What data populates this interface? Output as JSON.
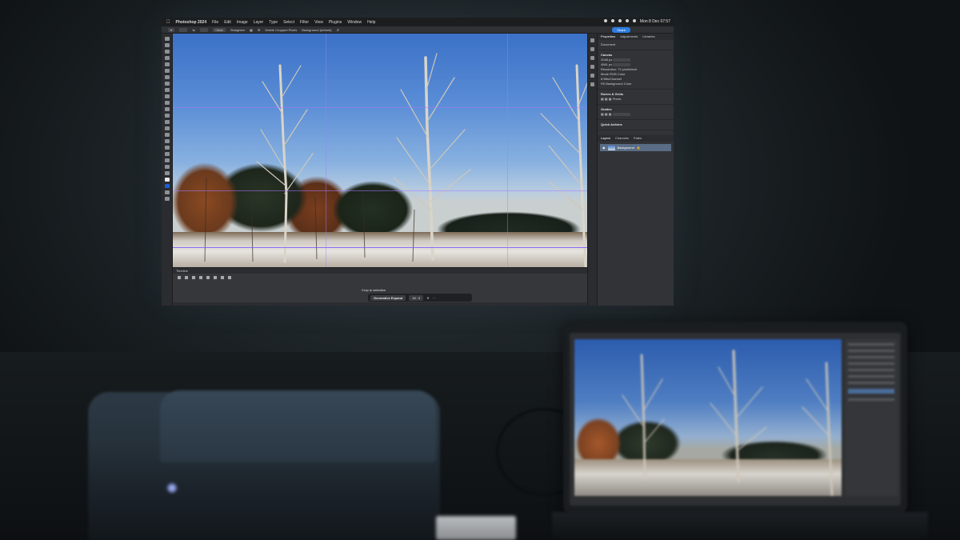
{
  "photoshop": {
    "app_name": "Photoshop 2024",
    "menus": [
      "File",
      "Edit",
      "Image",
      "Layer",
      "Type",
      "Select",
      "Filter",
      "View",
      "Plugins",
      "Window",
      "Help"
    ],
    "clock": "Mon 8 Dec  07:57",
    "share_label": "Share",
    "options": {
      "clear_label": "Clear",
      "straighten_label": "Straighten",
      "delete_cropped": "Delete Cropped Pixels",
      "fill_label": "Background (default)"
    },
    "panels": {
      "tabs": [
        "Properties",
        "Adjustments",
        "Libraries"
      ],
      "document_label": "Document",
      "canvas_header": "Canvas",
      "width_value": "2048 px",
      "height_value": "4561 px",
      "resolution": "Resolution: 72 pixels/inch",
      "mode_label": "Mode",
      "mode_value": "RGB Color",
      "bit_value": "8 Bits/Channel",
      "fill_label": "Fill",
      "fill_value": "Background Color",
      "rulers_header": "Rulers & Grids",
      "rulers_unit": "Pixels",
      "guides_header": "Guides",
      "quick_actions": "Quick Actions",
      "layers_tabs": [
        "Layers",
        "Channels",
        "Paths"
      ],
      "layer_name": "Background"
    },
    "timeline_label": "Timeline",
    "contextual": {
      "crop_label": "Crop to selection",
      "generative_expand": "Generative Expand",
      "ratio": "16 : 9"
    }
  }
}
